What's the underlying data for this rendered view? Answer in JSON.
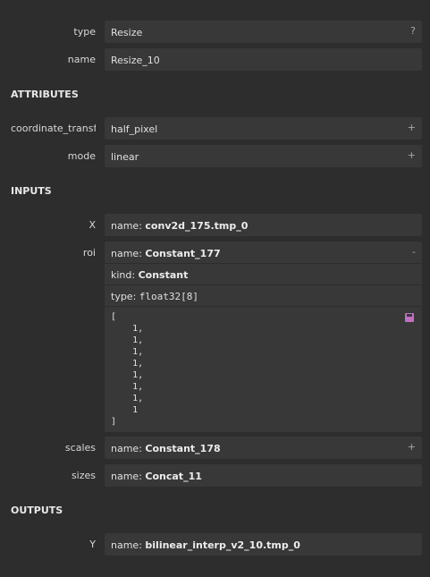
{
  "properties": {
    "type": {
      "label": "type",
      "value": "Resize",
      "button": "?"
    },
    "name": {
      "label": "name",
      "value": "Resize_10"
    }
  },
  "sections": {
    "attributes": "ATTRIBUTES",
    "inputs": "INPUTS",
    "outputs": "OUTPUTS"
  },
  "attributes": [
    {
      "label": "coordinate_transf...",
      "value": "half_pixel",
      "button": "+"
    },
    {
      "label": "mode",
      "value": "linear",
      "button": "+"
    }
  ],
  "inputs": {
    "x": {
      "label": "X",
      "name_prefix": "name: ",
      "name": "conv2d_175.tmp_0"
    },
    "roi": {
      "label": "roi",
      "name_prefix": "name: ",
      "name": "Constant_177",
      "collapse_button": "-",
      "kind_prefix": "kind: ",
      "kind": "Constant",
      "type_prefix": "type: ",
      "type": "float32[8]",
      "value_text": "[\n    1,\n    1,\n    1,\n    1,\n    1,\n    1,\n    1,\n    1\n]"
    },
    "scales": {
      "label": "scales",
      "name_prefix": "name: ",
      "name": "Constant_178",
      "button": "+"
    },
    "sizes": {
      "label": "sizes",
      "name_prefix": "name: ",
      "name": "Concat_11"
    }
  },
  "outputs": {
    "y": {
      "label": "Y",
      "name_prefix": "name: ",
      "name": "bilinear_interp_v2_10.tmp_0"
    }
  },
  "colors": {
    "background": "#2d2d2d",
    "field": "#383838",
    "save_icon": "#c070c0"
  }
}
